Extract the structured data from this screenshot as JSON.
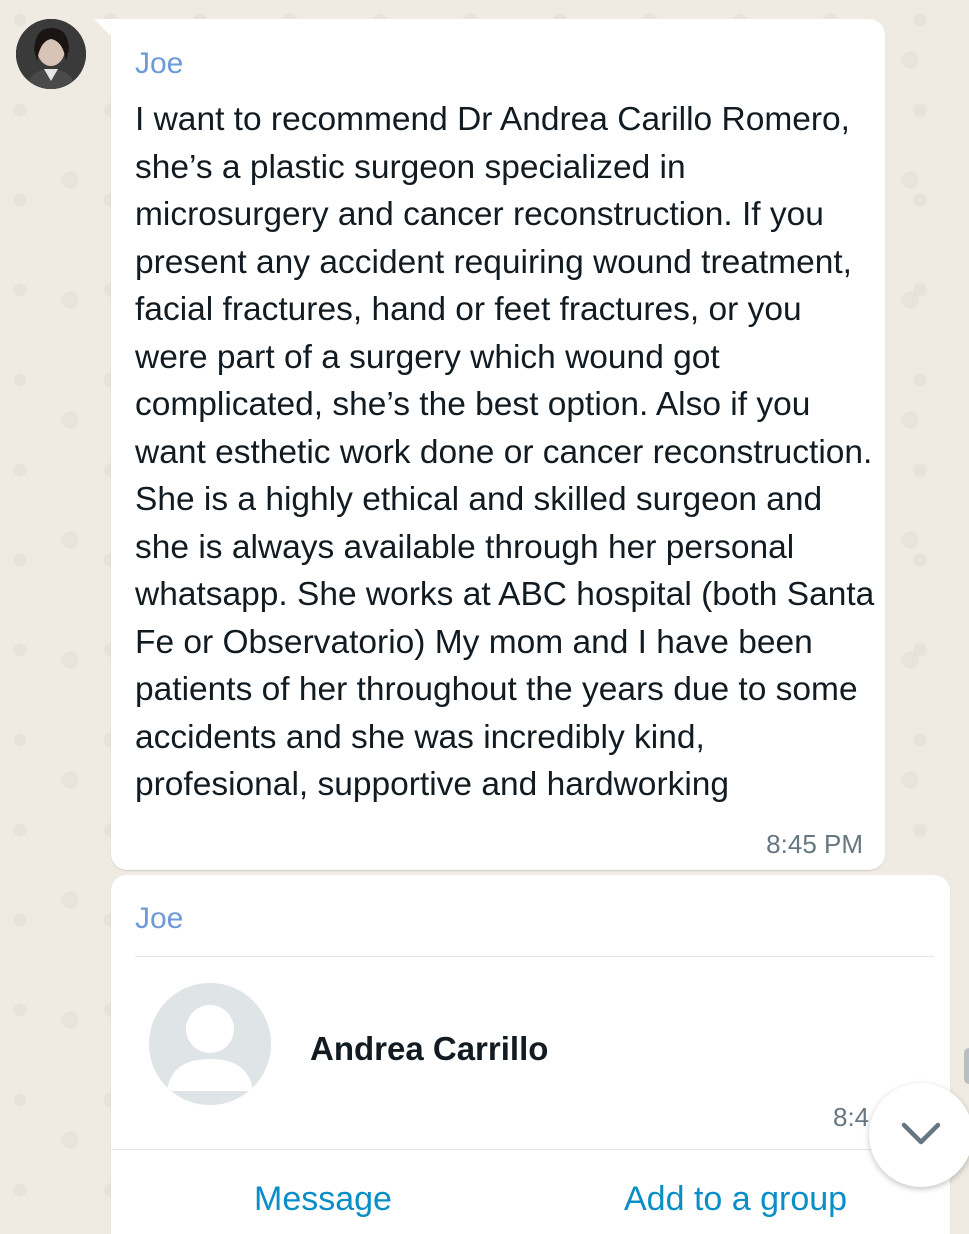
{
  "message": {
    "sender": "Joe",
    "text": "I want to recommend Dr Andrea Carillo Romero, she’s a plastic surgeon specialized in microsurgery and cancer reconstruction. If you present any accident requiring wound treatment, facial fractures, hand or feet fractures, or you were part of a surgery which wound got complicated, she’s the best option. Also if you want esthetic work done or cancer reconstruction. She is a highly ethical and skilled surgeon and she is always available through her personal whatsapp. She works at ABC hospital (both Santa Fe or Observatorio) My mom and I have been patients of her throughout the years due to some accidents and she was incredibly kind, profesional, supportive and hardworking",
    "time": "8:45 PM"
  },
  "contact_card": {
    "sender": "Joe",
    "contact_name": "Andrea Carrillo",
    "time": "8:4",
    "actions": {
      "message_label": "Message",
      "add_group_label": "Add to a group"
    }
  },
  "icons": {
    "scroll_down": "chevron-down-icon",
    "default_avatar": "person-icon"
  },
  "colors": {
    "sender_name": "#6e9ad8",
    "link_action": "#0a8ec8",
    "background": "#efeae2",
    "bubble": "#ffffff"
  }
}
